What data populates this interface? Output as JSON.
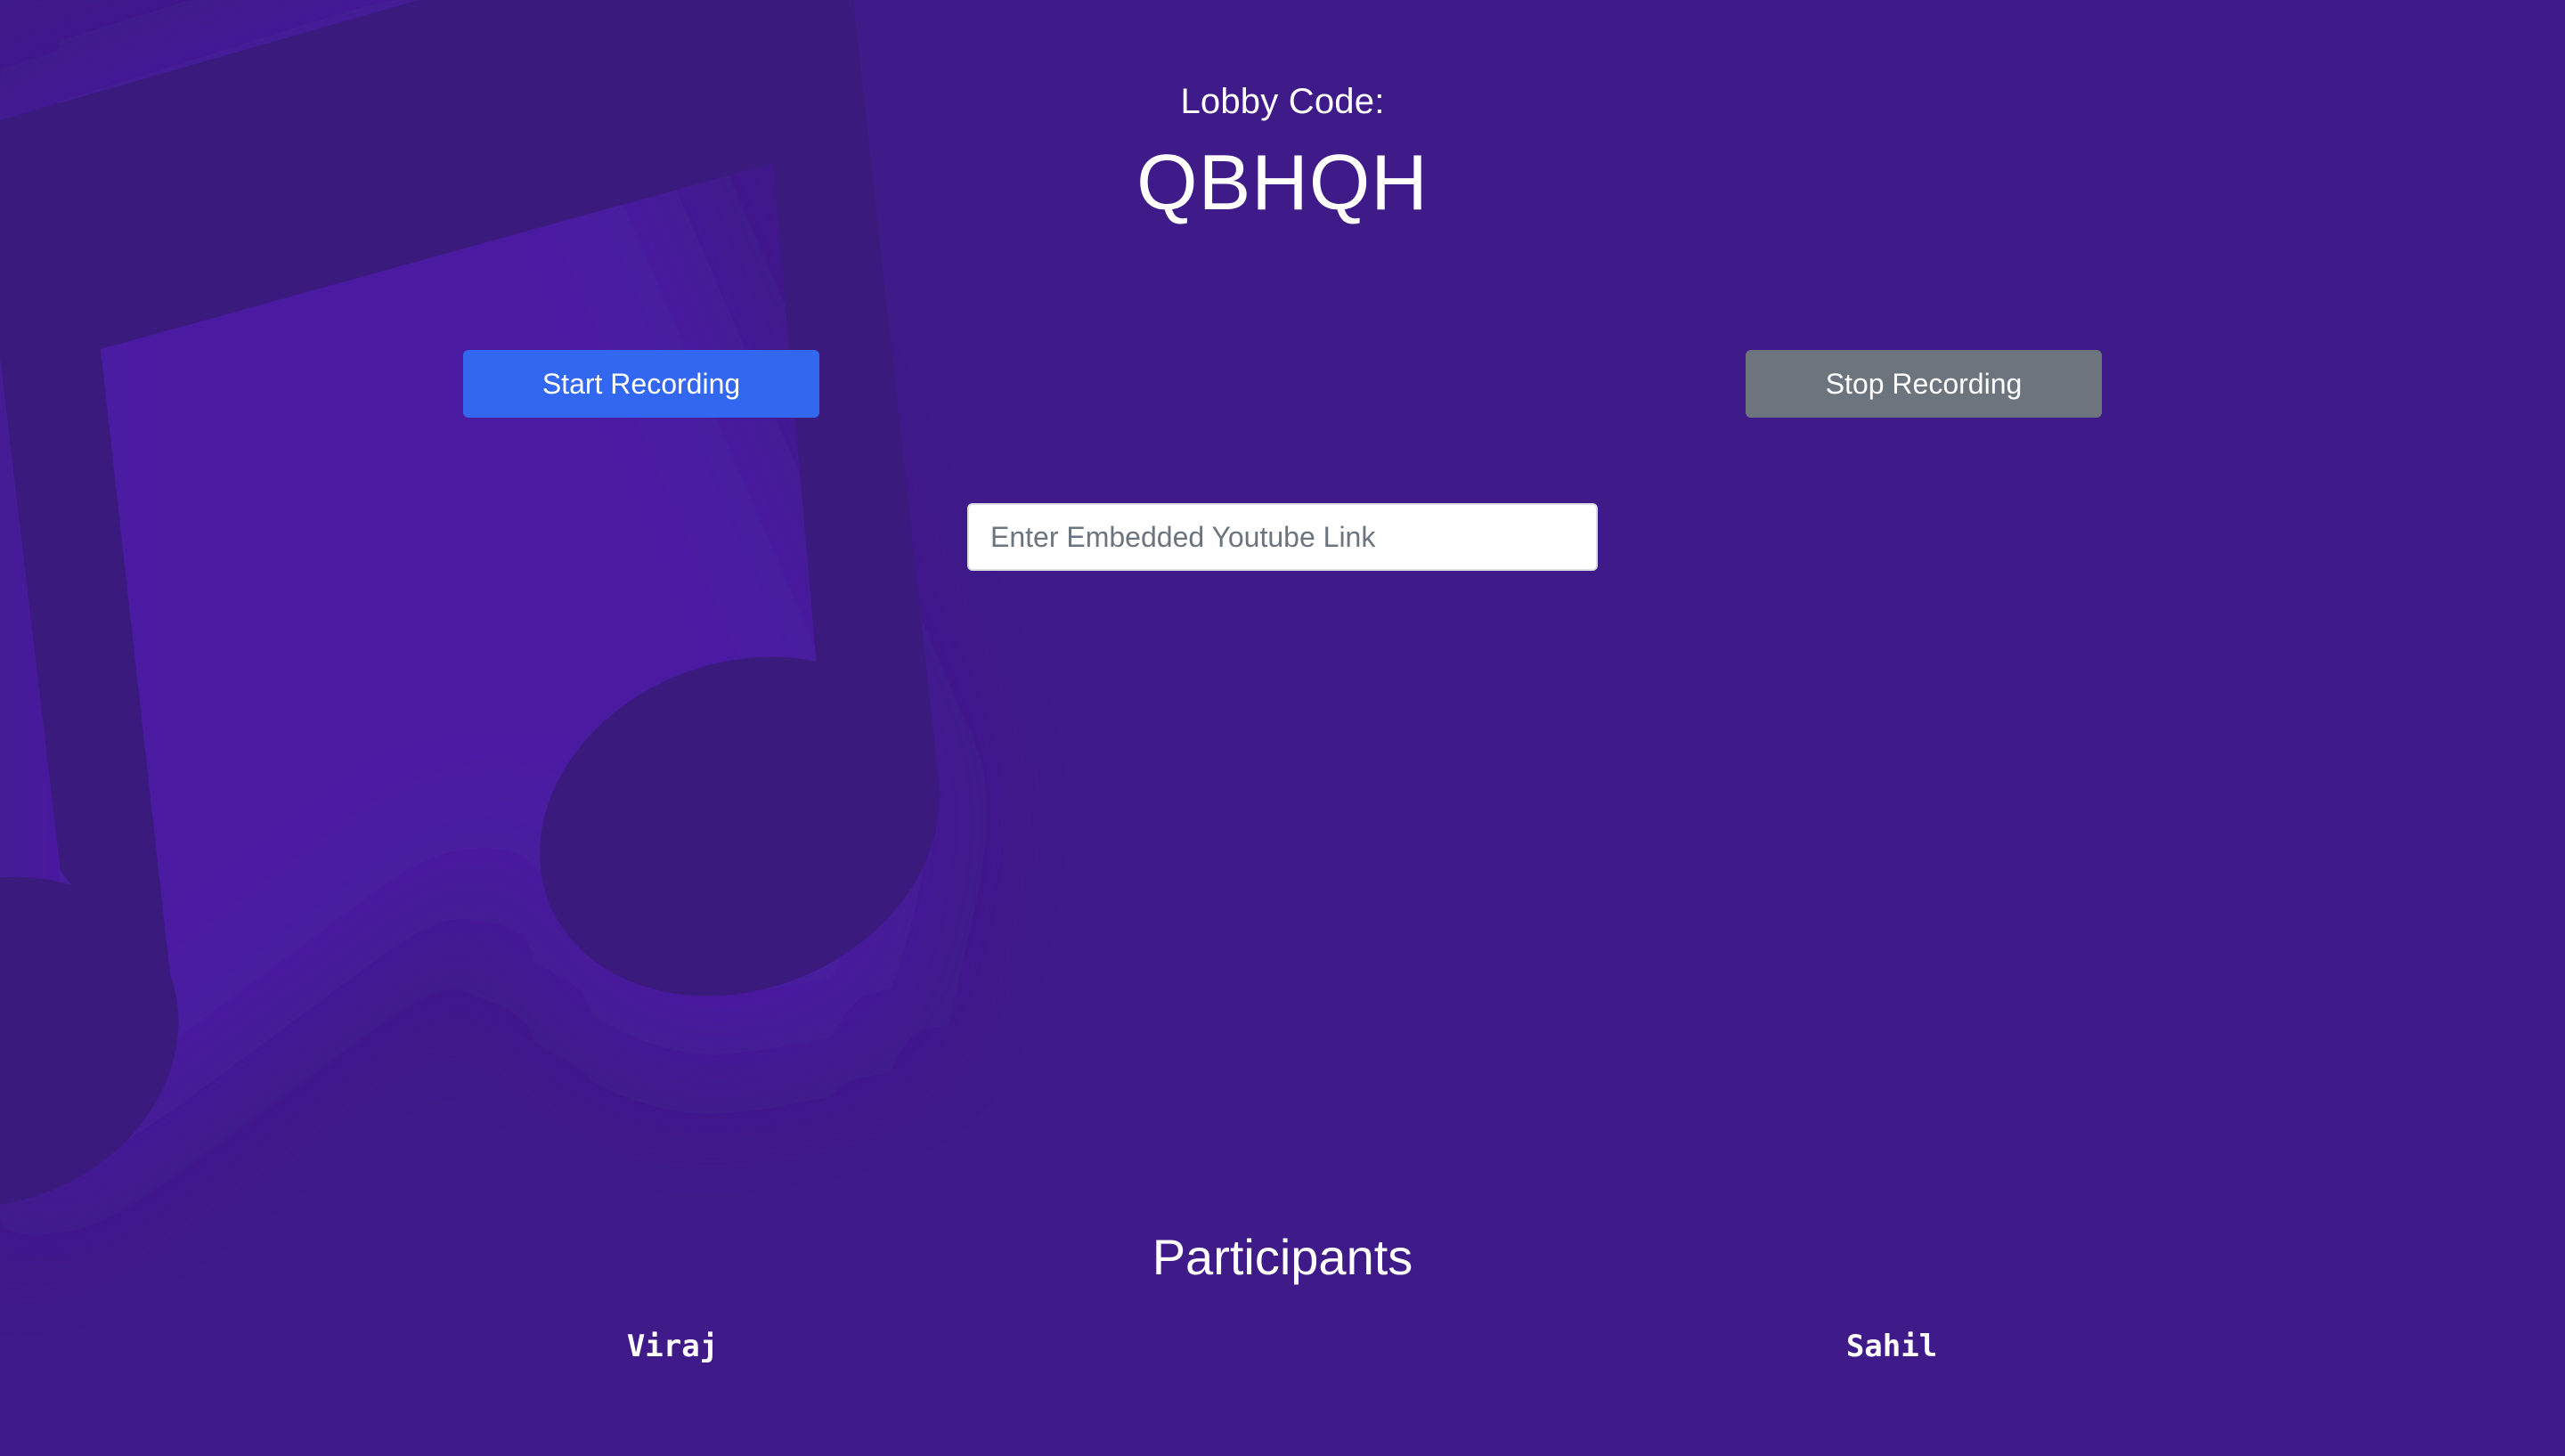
{
  "lobby": {
    "label": "Lobby Code:",
    "code": "QBHQH"
  },
  "controls": {
    "start_label": "Start Recording",
    "stop_label": "Stop Recording",
    "youtube_placeholder": "Enter Embedded Youtube Link",
    "youtube_value": ""
  },
  "participants": {
    "title": "Participants",
    "names": [
      "Viraj",
      "Sahil"
    ]
  },
  "colors": {
    "background": "#3f1a89",
    "music_note": "#3a1a7c",
    "start_button": "#3268f0",
    "stop_button": "#6c747d"
  },
  "icons": {
    "background_art": "music-note-icon"
  }
}
